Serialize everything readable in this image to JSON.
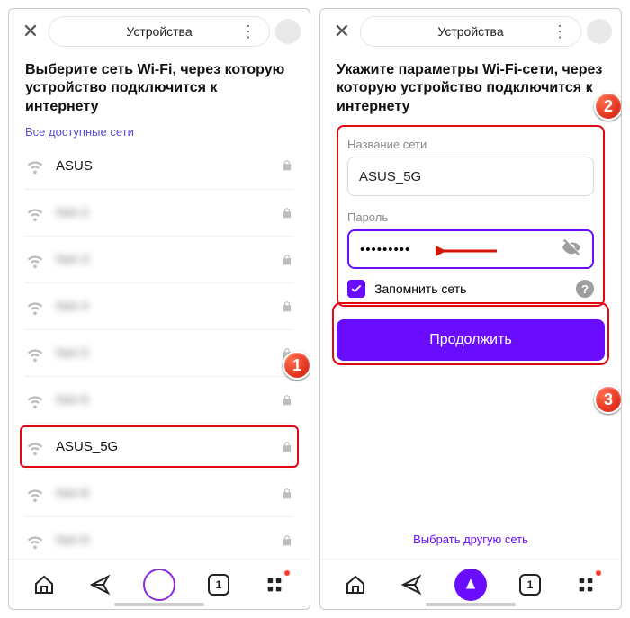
{
  "header": {
    "title": "Устройства",
    "close_glyph": "✕",
    "more_glyph": "⋮"
  },
  "left": {
    "heading": "Выберите сеть Wi-Fi, через которую устройство подключится к интернету",
    "all_networks_link": "Все доступные сети",
    "wifi_items": [
      {
        "name": "ASUS",
        "blur": false
      },
      {
        "name": "Net-2",
        "blur": true
      },
      {
        "name": "Net-3",
        "blur": true
      },
      {
        "name": "Net-4",
        "blur": true
      },
      {
        "name": "Net-5",
        "blur": true
      },
      {
        "name": "Net-6",
        "blur": true
      },
      {
        "name": "ASUS_5G",
        "blur": false,
        "selected": true
      },
      {
        "name": "Net-8",
        "blur": true
      },
      {
        "name": "Net-9",
        "blur": true
      }
    ],
    "callout1": "1"
  },
  "right": {
    "heading": "Укажите параметры Wi-Fi-сети, через которую устройство подключится к интернету",
    "label_ssid": "Название сети",
    "value_ssid": "ASUS_5G",
    "label_pwd": "Пароль",
    "value_pwd": "•••••••••",
    "remember_label": "Запомнить сеть",
    "continue_label": "Продолжить",
    "choose_other": "Выбрать другую сеть",
    "callout2": "2",
    "callout3": "3"
  },
  "nav": {
    "tab_count": "1"
  }
}
